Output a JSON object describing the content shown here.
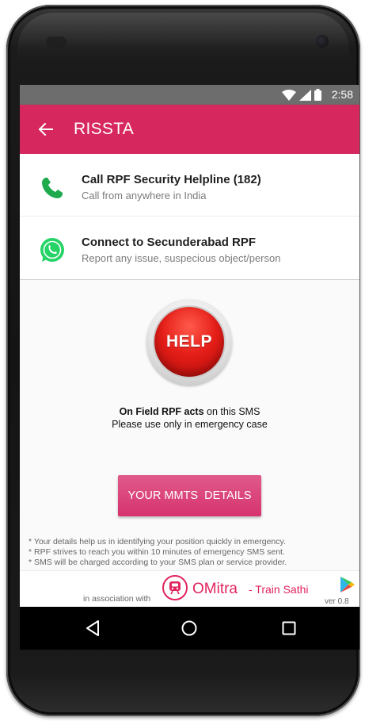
{
  "status_bar": {
    "time": "2:58",
    "icons": [
      "wifi-icon",
      "cell-signal-icon",
      "battery-icon"
    ]
  },
  "app_bar": {
    "title": "RISSTA",
    "back_icon": "arrow-back-icon"
  },
  "actions": [
    {
      "icon": "phone-icon",
      "title": "Call RPF Security Helpline (182)",
      "subtitle": "Call from anywhere in India"
    },
    {
      "icon": "whatsapp-icon",
      "title": "Connect to Secunderabad RPF",
      "subtitle": "Report any issue, suspecious object/person"
    }
  ],
  "help": {
    "button_label": "HELP",
    "note_bold": "On Field RPF acts",
    "note_rest": " on this SMS",
    "note_line2": "Please use only in emergency case"
  },
  "mmts_button_label": "YOUR MMTS  DETAILS",
  "footnotes": [
    "* Your details help us in identifying your position quickly in emergency.",
    "* RPF strives to reach you within 10 minutes of emergency SMS sent.",
    "* SMS will be charged according to your SMS plan or service provider."
  ],
  "association": {
    "prefix": "in association with",
    "brand": "OMitra",
    "tagline": "- Train Sathi",
    "version": "ver 0.8",
    "icons": [
      "omitra-train-logo-icon",
      "play-store-icon"
    ]
  },
  "nav_bar": {
    "icons": [
      "nav-back-icon",
      "nav-home-icon",
      "nav-recents-icon"
    ]
  },
  "colors": {
    "accent": "#d6275f",
    "button": "#d6336e",
    "phone_green": "#1eab4e",
    "whatsapp_green": "#25d366",
    "help_red": "#e51e18",
    "brand_pink": "#e0245e"
  }
}
